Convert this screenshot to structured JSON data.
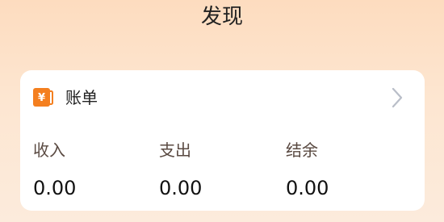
{
  "header": {
    "title": "发现"
  },
  "bill_card": {
    "title": "账单",
    "icon": "wallet-yen-icon",
    "icon_symbol": "¥",
    "accent_color": "#F47F1F",
    "stats": [
      {
        "label": "收入",
        "value": "0.00"
      },
      {
        "label": "支出",
        "value": "0.00"
      },
      {
        "label": "结余",
        "value": "0.00"
      }
    ]
  }
}
